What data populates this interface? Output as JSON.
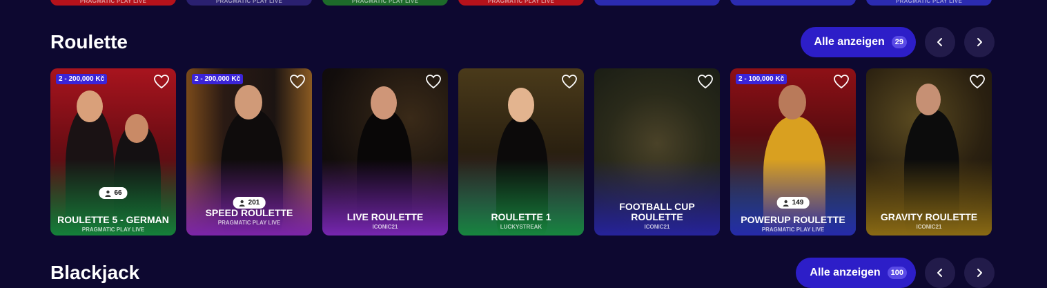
{
  "top_row": [
    {
      "label": "PRAGMATIC PLAY LIVE",
      "color": "#b5121b"
    },
    {
      "label": "PRAGMATIC PLAY LIVE",
      "color": "#2a2070"
    },
    {
      "label": "PRAGMATIC PLAY LIVE",
      "color": "#1d6b2a"
    },
    {
      "label": "PRAGMATIC PLAY LIVE",
      "color": "#b5121b"
    },
    {
      "label": "",
      "color": "#2b2bb0"
    },
    {
      "label": "",
      "color": "#2b2bb0"
    },
    {
      "label": "PRAGMATIC PLAY LIVE",
      "color": "#2b2bb0"
    }
  ],
  "roulette": {
    "title": "Roulette",
    "show_all_label": "Alle anzeigen",
    "count": "29",
    "cards": [
      {
        "name": "Roulette 5 - German",
        "provider": "PRAGMATIC PLAY LIVE",
        "bet": "2 - 200,000 Kč",
        "players": "66"
      },
      {
        "name": "Speed Roulette",
        "provider": "PRAGMATIC PLAY LIVE",
        "bet": "2 - 200,000 Kč",
        "players": "201"
      },
      {
        "name": "Live Roulette",
        "provider": "ICONIC21"
      },
      {
        "name": "Roulette 1",
        "provider": "LUCKYSTREAK"
      },
      {
        "name": "Football Cup Roulette",
        "provider": "ICONIC21"
      },
      {
        "name": "Powerup Roulette",
        "provider": "PRAGMATIC PLAY LIVE",
        "bet": "2 - 100,000 Kč",
        "players": "149"
      },
      {
        "name": "Gravity Roulette",
        "provider": "ICONIC21"
      }
    ]
  },
  "blackjack": {
    "title": "Blackjack",
    "show_all_label": "Alle anzeigen",
    "count": "100"
  },
  "colors": {
    "background": "#0d0830",
    "accent": "#2d1ec8",
    "badge": "#3b24d8"
  },
  "icons": [
    "heart-icon",
    "user-icon",
    "chevron-left-icon",
    "chevron-right-icon"
  ]
}
